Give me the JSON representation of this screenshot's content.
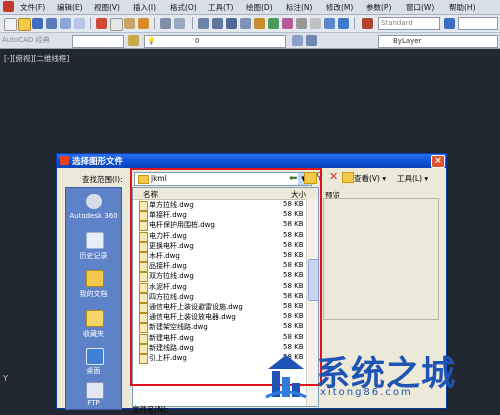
{
  "menubar": {
    "items": [
      "文件(F)",
      "编辑(E)",
      "视图(V)",
      "插入(I)",
      "格式(O)",
      "工具(T)",
      "绘图(D)",
      "标注(N)",
      "修改(M)",
      "参数(P)",
      "窗口(W)",
      "帮助(H)"
    ]
  },
  "toolbar": {
    "style_value": "Standard",
    "workspace_label": "AutoCAD 经典",
    "layer_value": "0",
    "color_value": "ByLayer"
  },
  "viewport": {
    "label": "[-][俯视][二维线框]",
    "y_axis": "Y"
  },
  "dialog": {
    "title": "选择图形文件",
    "close": "×",
    "lookin_label": "查找范围(I):",
    "lookin_value": "jkml",
    "view_menu": "查看(V) ▾",
    "tools_menu": "工具(L) ▾",
    "preview_label": "预览",
    "filename_label": "文件名(N):",
    "places": [
      "Autodesk 360",
      "历史记录",
      "我的文档",
      "收藏夹",
      "桌面",
      "FTP"
    ],
    "columns": {
      "name": "名称",
      "size": "大小"
    },
    "files": [
      {
        "name": "单方拉线.dwg",
        "size": "58 KB"
      },
      {
        "name": "单接杆.dwg",
        "size": "58 KB"
      },
      {
        "name": "电杆保护用围桩.dwg",
        "size": "58 KB"
      },
      {
        "name": "电力杆.dwg",
        "size": "58 KB"
      },
      {
        "name": "更换电杆.dwg",
        "size": "58 KB"
      },
      {
        "name": "木杆.dwg",
        "size": "58 KB"
      },
      {
        "name": "品接杆.dwg",
        "size": "58 KB"
      },
      {
        "name": "双方拉线.dwg",
        "size": "58 KB"
      },
      {
        "name": "水泥杆.dwg",
        "size": "58 KB"
      },
      {
        "name": "四方拉线.dwg",
        "size": "58 KB"
      },
      {
        "name": "通信电杆上装设避雷设施.dwg",
        "size": "58 KB"
      },
      {
        "name": "通信电杆上装设放电器.dwg",
        "size": "58 KB"
      },
      {
        "name": "新建架空线路.dwg",
        "size": "58 KB"
      },
      {
        "name": "新建电杆.dwg",
        "size": "58 KB"
      },
      {
        "name": "新建线路.dwg",
        "size": "58 KB"
      },
      {
        "name": "引上杆.dwg",
        "size": "58 KB"
      }
    ]
  },
  "watermark": {
    "name": "系统之城",
    "url": "xitong86.com"
  },
  "colors": {
    "accent_red": "#e0141e",
    "title_blue": "#0a4fd3",
    "watermark_blue": "#1d54b5"
  }
}
